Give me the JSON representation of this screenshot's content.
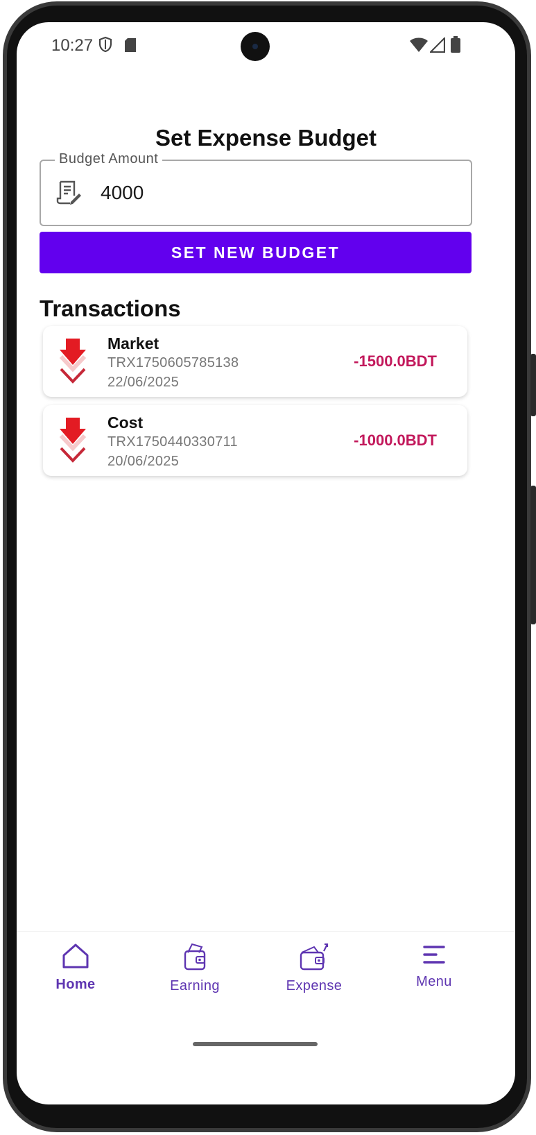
{
  "status_bar": {
    "time": "10:27"
  },
  "page": {
    "title": "Set Expense Budget"
  },
  "budget": {
    "label": "Budget Amount",
    "value": "4000",
    "button_label": "SET NEW BUDGET"
  },
  "transactions": {
    "title": "Transactions",
    "items": [
      {
        "name": "Market",
        "id": "TRX1750605785138",
        "date": "22/06/2025",
        "amount": "-1500.0BDT"
      },
      {
        "name": "Cost",
        "id": "TRX1750440330711",
        "date": "20/06/2025",
        "amount": "-1000.0BDT"
      }
    ]
  },
  "nav": {
    "items": [
      {
        "label": "Home",
        "icon": "home-icon",
        "active": true
      },
      {
        "label": "Earning",
        "icon": "wallet-money-icon",
        "active": false
      },
      {
        "label": "Expense",
        "icon": "wallet-out-icon",
        "active": false
      },
      {
        "label": "Menu",
        "icon": "menu-icon",
        "active": false
      }
    ]
  },
  "colors": {
    "accent": "#6200ee",
    "nav": "#5e35b1",
    "amount": "#c2185b",
    "arrow": "#e53935"
  }
}
